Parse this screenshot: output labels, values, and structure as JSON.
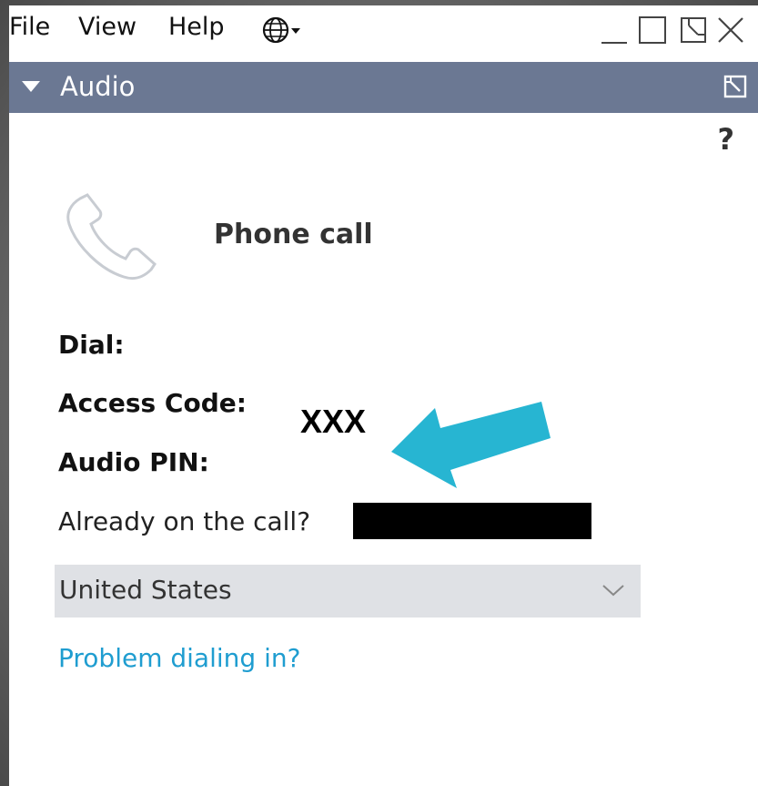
{
  "menu": {
    "file": "File",
    "view": "View",
    "help": "Help",
    "globe_icon": "globe-icon"
  },
  "window_controls": [
    "minimize-icon",
    "maximize-icon",
    "restore-icon",
    "close-icon"
  ],
  "panel": {
    "title": "Audio",
    "help": "?"
  },
  "content": {
    "phone_call": "Phone call",
    "dial_label": "Dial:",
    "access_code_label": "Access Code:",
    "audio_pin_label": "Audio PIN:",
    "annotation": "XXX",
    "already_on_call": "Already on the call?",
    "country_select": "United States",
    "problem_link": "Problem dialing in?"
  },
  "colors": {
    "titlebar": "#6b7893",
    "link": "#1f9dd0",
    "arrow": "#27b5d2",
    "select_bg": "#dfe1e5"
  }
}
